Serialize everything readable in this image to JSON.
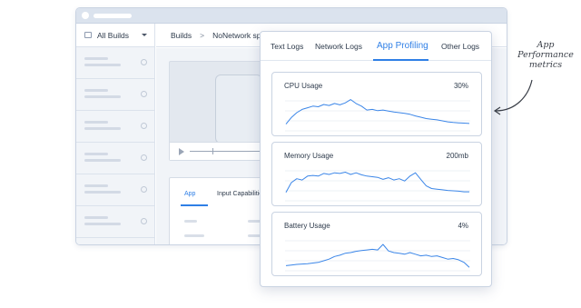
{
  "background_window": {
    "sidebar": {
      "header_label": "All Builds"
    },
    "breadcrumb": {
      "root": "Builds",
      "separator": ">",
      "current": "NoNetwork sp"
    },
    "tabs": [
      {
        "label": "App",
        "active": true
      },
      {
        "label": "Input Capabilities",
        "active": false
      }
    ]
  },
  "panel": {
    "tabs": [
      {
        "label": "Text Logs",
        "active": false
      },
      {
        "label": "Network Logs",
        "active": false
      },
      {
        "label": "App Profiling",
        "active": true
      },
      {
        "label": "Other Logs",
        "active": false
      }
    ],
    "metrics": [
      {
        "title": "CPU Usage",
        "value": "30%"
      },
      {
        "title": "Memory Usage",
        "value": "200mb"
      },
      {
        "title": "Battery Usage",
        "value": "4%"
      }
    ]
  },
  "annotation": {
    "line1": "App",
    "line2": "Performance",
    "line3": "metrics"
  },
  "colors": {
    "accent": "#2f7fe6",
    "line": "#3b86e8",
    "border": "#c9d3e2"
  },
  "chart_data": [
    {
      "type": "line",
      "title": "CPU Usage",
      "values": [
        0.15,
        0.35,
        0.5,
        0.6,
        0.65,
        0.7,
        0.68,
        0.75,
        0.72,
        0.78,
        0.74,
        0.8,
        0.9,
        0.78,
        0.7,
        0.58,
        0.6,
        0.56,
        0.58,
        0.55,
        0.52,
        0.5,
        0.48,
        0.45,
        0.4,
        0.36,
        0.32,
        0.3,
        0.28,
        0.25,
        0.22,
        0.2,
        0.19,
        0.18,
        0.17
      ]
    },
    {
      "type": "line",
      "title": "Memory Usage",
      "values": [
        0.2,
        0.5,
        0.62,
        0.58,
        0.7,
        0.72,
        0.7,
        0.78,
        0.75,
        0.8,
        0.78,
        0.82,
        0.75,
        0.8,
        0.74,
        0.7,
        0.68,
        0.66,
        0.6,
        0.65,
        0.58,
        0.62,
        0.55,
        0.7,
        0.8,
        0.6,
        0.4,
        0.32,
        0.3,
        0.28,
        0.26,
        0.25,
        0.24,
        0.22,
        0.22
      ]
    },
    {
      "type": "line",
      "title": "Battery Usage",
      "values": [
        0.1,
        0.12,
        0.14,
        0.15,
        0.16,
        0.18,
        0.2,
        0.25,
        0.3,
        0.38,
        0.42,
        0.48,
        0.5,
        0.54,
        0.56,
        0.58,
        0.6,
        0.58,
        0.75,
        0.55,
        0.5,
        0.48,
        0.45,
        0.5,
        0.45,
        0.4,
        0.42,
        0.38,
        0.4,
        0.35,
        0.3,
        0.32,
        0.28,
        0.2,
        0.05
      ]
    }
  ]
}
